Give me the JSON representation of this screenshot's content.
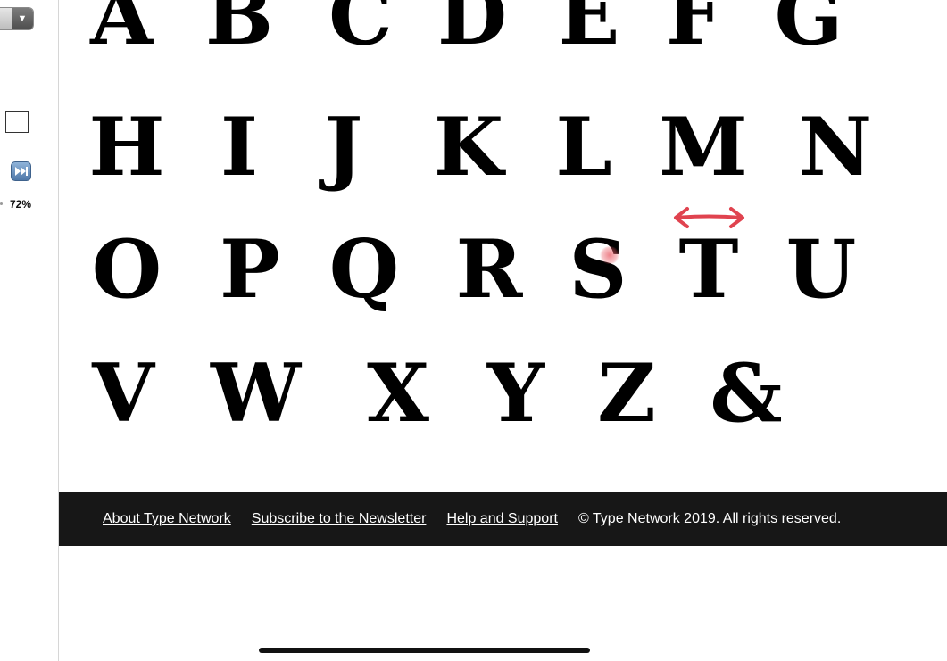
{
  "sidebar": {
    "dropdown_arrow": "▼",
    "fast_forward_icon": "⏭",
    "zoom_level": "72%"
  },
  "glyphs": {
    "row1": [
      "A",
      "B",
      "C",
      "D",
      "E",
      "F",
      "G"
    ],
    "row2": [
      "H",
      "I",
      "J",
      "K",
      "L",
      "M",
      "N"
    ],
    "row3": [
      "O",
      "P",
      "Q",
      "R",
      "S",
      "T",
      "U"
    ],
    "row4": [
      "V",
      "W",
      "X",
      "Y",
      "Z",
      "&"
    ]
  },
  "footer": {
    "about": "About Type Network",
    "newsletter": "Subscribe to the Newsletter",
    "help": "Help and Support",
    "copyright": "© Type Network 2019. All rights reserved."
  },
  "colors": {
    "annotation": "#e0434f",
    "footer_bg": "#171717"
  },
  "icons": [
    "chevron-down-icon",
    "fast-forward-icon",
    "double-arrow-annotation-icon"
  ]
}
